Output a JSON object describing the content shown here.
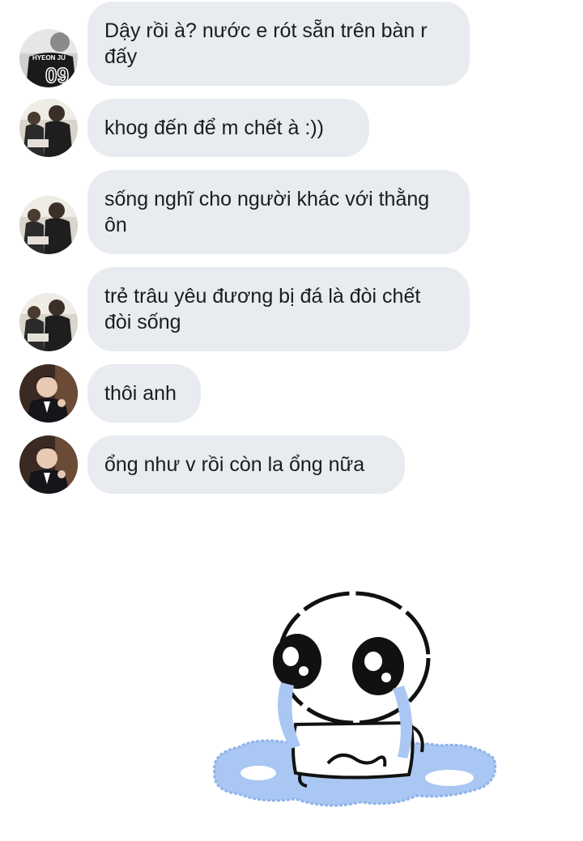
{
  "conversation": {
    "messages": [
      {
        "text": "Dậy rồi à? nước e rót sẵn trên bàn r đấy",
        "avatar": "user-a"
      },
      {
        "text": "khog đến để m chết à :))",
        "avatar": "user-b"
      },
      {
        "text": "sống nghĩ cho người khác với thằng ôn",
        "avatar": "user-b"
      },
      {
        "text": "trẻ trâu yêu đương bị đá là đòi chết đòi sống",
        "avatar": "user-b"
      },
      {
        "text": "thôi anh",
        "avatar": "user-c"
      },
      {
        "text": "ổng như v rồi còn la ổng nữa",
        "avatar": "user-c"
      }
    ],
    "avatar_a_jersey_text": "HYEON JU",
    "sticker": {
      "icon": "crying-blob-sticker",
      "puddle_color": "#a9c7f2"
    }
  }
}
